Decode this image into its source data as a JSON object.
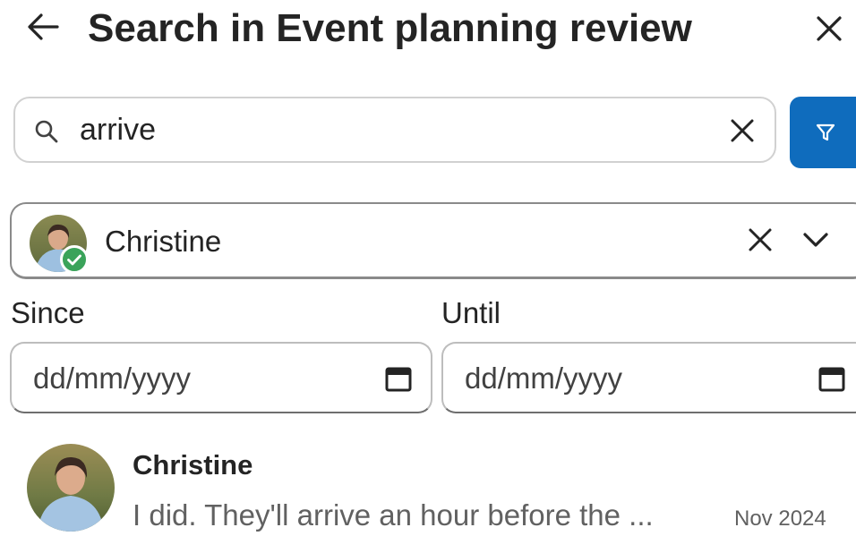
{
  "header": {
    "title": "Search in Event planning review"
  },
  "search": {
    "value": "arrive",
    "accent_color": "#0f6cbd"
  },
  "person_filter": {
    "name": "Christine",
    "status": "available",
    "status_color": "#3aa35a"
  },
  "dates": {
    "since_label": "Since",
    "until_label": "Until",
    "since_placeholder": "dd/mm/yyyy",
    "until_placeholder": "dd/mm/yyyy"
  },
  "results": [
    {
      "sender": "Christine",
      "snippet": "I did. They'll arrive an hour before the ...",
      "date": "Nov 2024"
    }
  ]
}
